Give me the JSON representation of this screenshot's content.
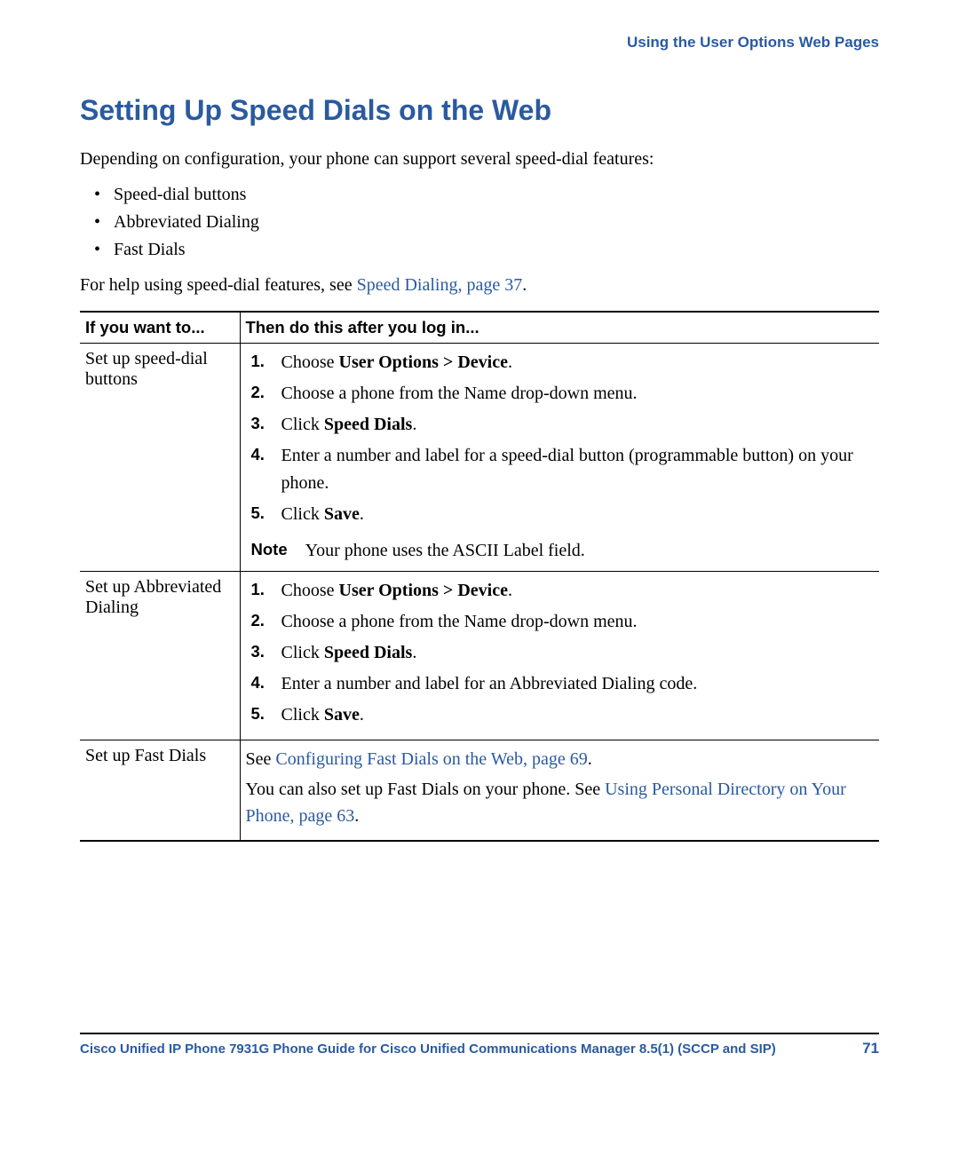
{
  "running_head": "Using the User Options Web Pages",
  "title": "Setting Up Speed Dials on the Web",
  "intro": "Depending on configuration, your phone can support several speed-dial features:",
  "bullets": [
    "Speed-dial buttons",
    "Abbreviated Dialing",
    "Fast Dials"
  ],
  "post_list_pre": "For help using speed-dial features, see ",
  "post_list_link": "Speed Dialing, page 37",
  "post_list_post": ".",
  "table": {
    "head": {
      "c1": "If you want to...",
      "c2": "Then do this after you log in..."
    },
    "rows": [
      {
        "c1": "Set up speed-dial buttons",
        "steps": [
          {
            "pre": "Choose ",
            "bold": "User Options > Device",
            "post": "."
          },
          {
            "pre": "Choose a phone from the Name drop-down menu."
          },
          {
            "pre": "Click ",
            "bold": "Speed Dials",
            "post": "."
          },
          {
            "pre": "Enter a number and label for a speed-dial button (programmable button) on your phone."
          },
          {
            "pre": "Click ",
            "bold": "Save",
            "post": "."
          }
        ],
        "note_label": "Note",
        "note_text": "Your phone uses the ASCII Label field."
      },
      {
        "c1": "Set up Abbreviated Dialing",
        "steps": [
          {
            "pre": "Choose ",
            "bold": "User Options > Device",
            "post": "."
          },
          {
            "pre": "Choose a phone from the Name drop-down menu."
          },
          {
            "pre": "Click ",
            "bold": "Speed Dials",
            "post": "."
          },
          {
            "pre": "Enter a number and label for an Abbreviated Dialing code."
          },
          {
            "pre": "Click ",
            "bold": "Save",
            "post": "."
          }
        ]
      },
      {
        "c1": "Set up Fast Dials",
        "para1_pre": "See ",
        "para1_link": "Configuring Fast Dials on the Web, page 69",
        "para1_post": ".",
        "para2_pre": "You can also set up Fast Dials on your phone. See ",
        "para2_link": "Using Personal Directory on Your Phone, page 63",
        "para2_post": "."
      }
    ]
  },
  "footer": {
    "title": "Cisco Unified IP Phone 7931G Phone Guide for Cisco Unified Communications Manager 8.5(1) (SCCP and SIP)",
    "page": "71"
  }
}
